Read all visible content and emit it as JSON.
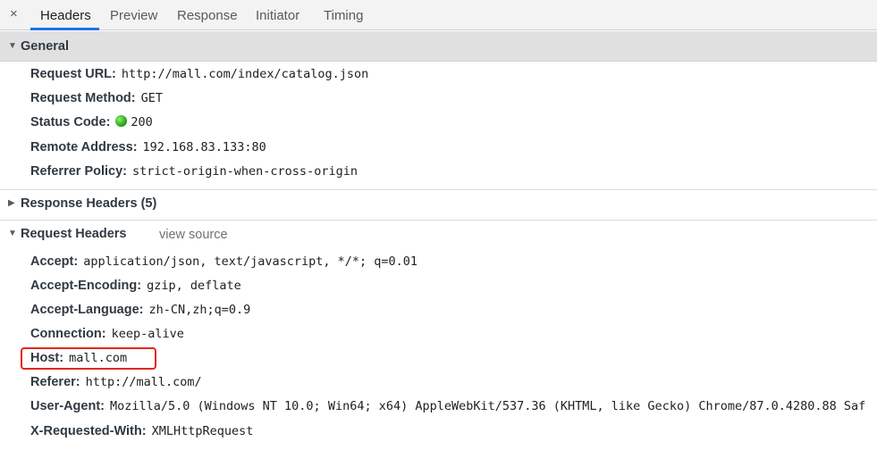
{
  "tabs": {
    "close_glyph": "×",
    "items": [
      "Headers",
      "Preview",
      "Response",
      "Initiator",
      "Timing"
    ],
    "active": "Headers"
  },
  "general": {
    "title": "General",
    "rows": [
      {
        "key": "Request URL:",
        "value": "http://mall.com/index/catalog.json"
      },
      {
        "key": "Request Method:",
        "value": "GET"
      },
      {
        "key": "Status Code:",
        "value": "200"
      },
      {
        "key": "Remote Address:",
        "value": "192.168.83.133:80"
      },
      {
        "key": "Referrer Policy:",
        "value": "strict-origin-when-cross-origin"
      }
    ]
  },
  "response_headers": {
    "title": "Response Headers (5)",
    "expanded": false
  },
  "request_headers": {
    "title": "Request Headers",
    "view_source": "view source",
    "rows": [
      {
        "key": "Accept:",
        "value": "application/json, text/javascript, */*; q=0.01"
      },
      {
        "key": "Accept-Encoding:",
        "value": "gzip, deflate"
      },
      {
        "key": "Accept-Language:",
        "value": "zh-CN,zh;q=0.9"
      },
      {
        "key": "Connection:",
        "value": "keep-alive"
      },
      {
        "key": "Host:",
        "value": "mall.com"
      },
      {
        "key": "Referer:",
        "value": "http://mall.com/"
      },
      {
        "key": "User-Agent:",
        "value": "Mozilla/5.0 (Windows NT 10.0; Win64; x64) AppleWebKit/537.36 (KHTML, like Gecko) Chrome/87.0.4280.88 Saf"
      },
      {
        "key": "X-Requested-With:",
        "value": "XMLHttpRequest"
      }
    ]
  },
  "colors": {
    "accent": "#1a73e8",
    "status_ok": "#1d9a12",
    "highlight_box": "#e0271f"
  }
}
